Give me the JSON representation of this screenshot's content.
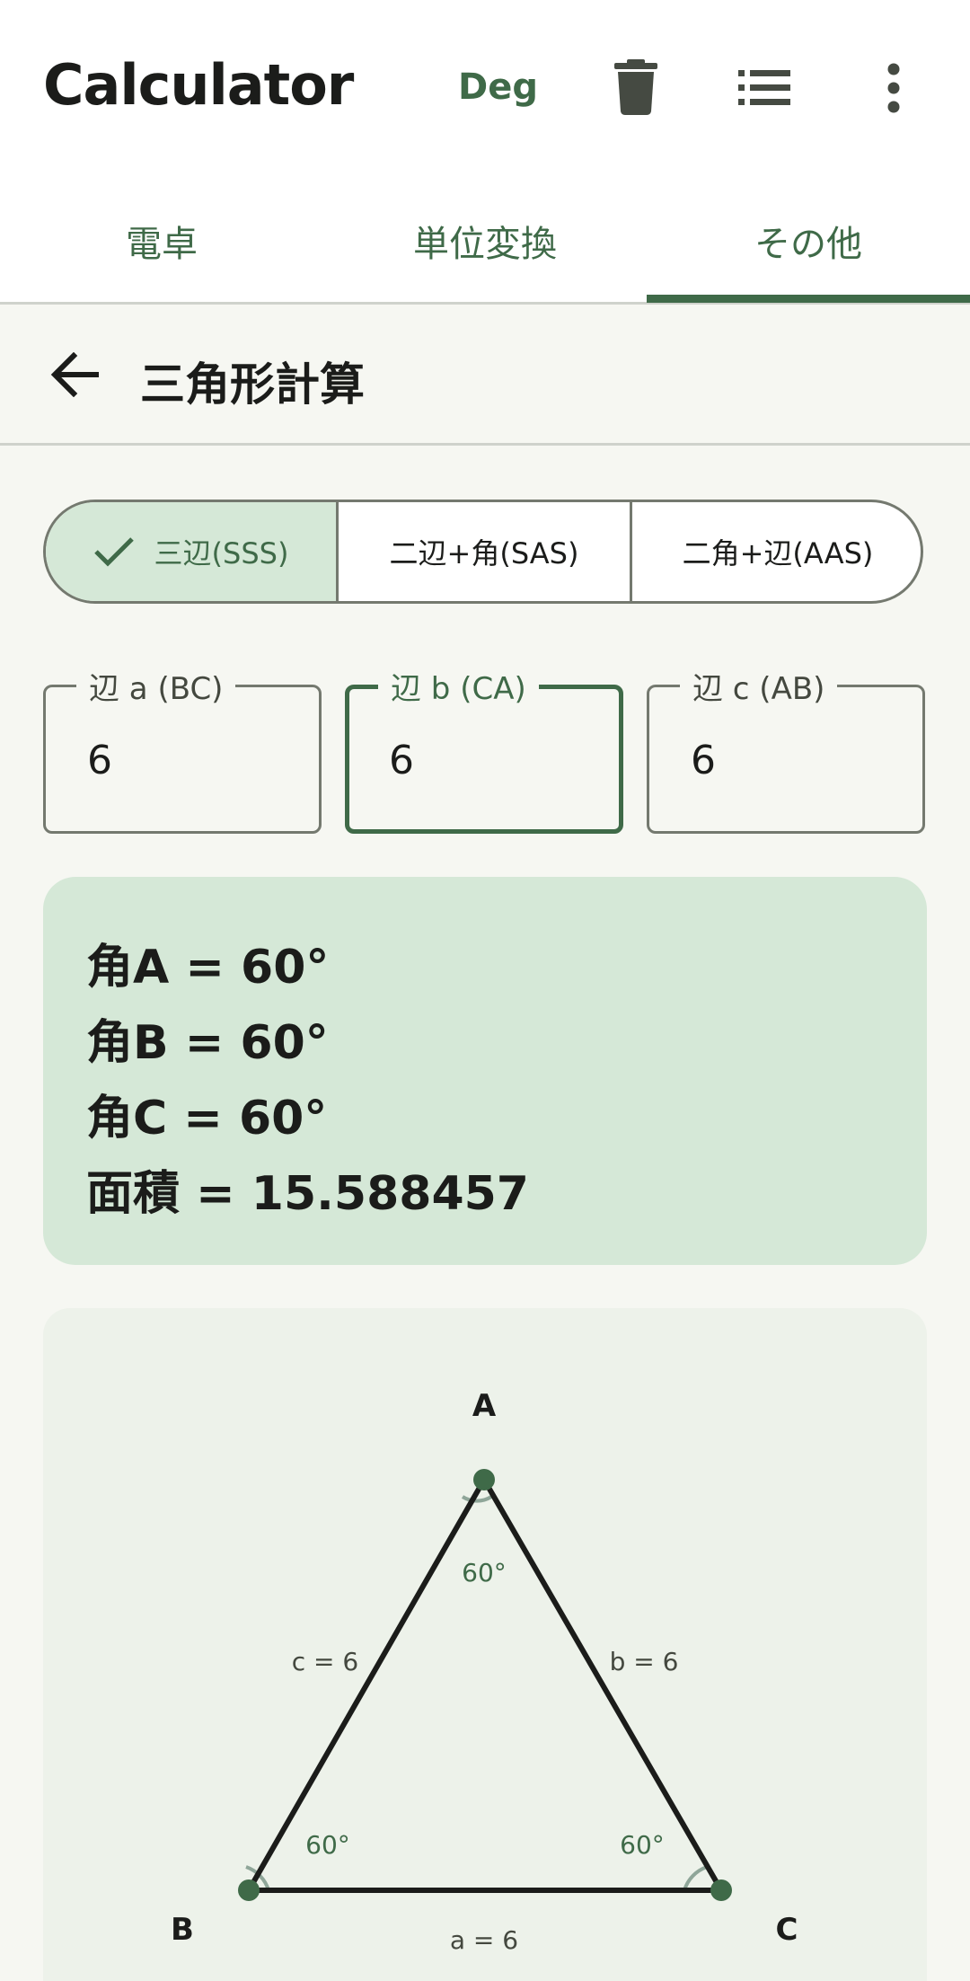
{
  "app_bar": {
    "title": "Calculator",
    "angle_mode": "Deg",
    "icons": [
      "delete-icon",
      "history-list-icon",
      "more-vert-icon"
    ]
  },
  "tabs": [
    {
      "label": "電卓"
    },
    {
      "label": "単位変換"
    },
    {
      "label": "その他"
    }
  ],
  "selected_tab": 2,
  "sub_header": {
    "title": "三角形計算"
  },
  "modes": [
    {
      "label": "三辺(SSS)",
      "selected": true
    },
    {
      "label": "二辺+角(SAS)",
      "selected": false
    },
    {
      "label": "二角+辺(AAS)",
      "selected": false
    }
  ],
  "fields": [
    {
      "label": "辺 a (BC)",
      "value": "6",
      "focused": false
    },
    {
      "label": "辺 b (CA)",
      "value": "6",
      "focused": true
    },
    {
      "label": "辺 c (AB)",
      "value": "6",
      "focused": false
    }
  ],
  "results": [
    "角A = 60°",
    "角B = 60°",
    "角C = 60°",
    "面積 = 15.588457"
  ],
  "triangle": {
    "sides": {
      "a": 6,
      "b": 6,
      "c": 6
    },
    "angles": {
      "A": 60,
      "B": 60,
      "C": 60
    },
    "vertex_labels": {
      "A": "A",
      "B": "B",
      "C": "C"
    },
    "side_labels": {
      "a": "a = 6",
      "b": "b = 6",
      "c": "c = 6"
    },
    "angle_labels": {
      "A": "60°",
      "B": "60°",
      "C": "60°"
    }
  },
  "colors": {
    "primary": "#3f6a48",
    "container": "#d5e8d7",
    "background": "#f6f7f2",
    "diagram_bg": "#edf2ea",
    "outline": "#74796f"
  }
}
